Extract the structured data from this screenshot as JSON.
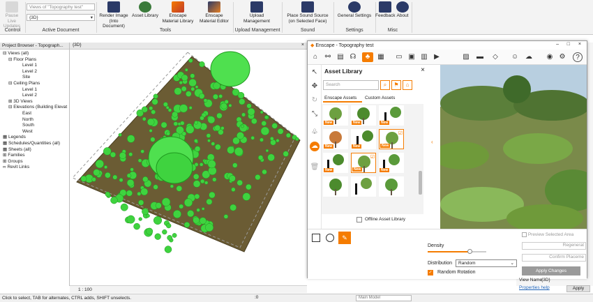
{
  "ribbon": {
    "pause_label": "Pause Live Updates",
    "view_combo": "Views of \"Topography test\"",
    "view_select": "{3D}",
    "render_image": "Render Image (Into Document)",
    "asset_library": "Asset Library",
    "material_library": "Enscape Material Library",
    "material_editor": "Enscape Material Editor",
    "upload": "Upload Management",
    "place_sound": "Place Sound Source (on Selected Face)",
    "general_settings": "General Settings",
    "feedback": "Feedback",
    "about": "About",
    "groups": {
      "control": "Control",
      "active_document": "Active Document",
      "tools": "Tools",
      "upload_mgmt": "Upload Management",
      "sound": "Sound",
      "settings": "Settings",
      "misc": "Misc"
    }
  },
  "project_browser": {
    "title": "Project Browser - Topograph...",
    "items": [
      "Views (all)",
      "Floor Plans",
      "Level 1",
      "Level 2",
      "Site",
      "Ceiling Plans",
      "Level 1",
      "Level 2",
      "3D Views",
      "Elevations (Building Elevat",
      "East",
      "North",
      "South",
      "West",
      "Legends",
      "Schedules/Quantities (all)",
      "Sheets (all)",
      "Families",
      "Groups",
      "Revit Links"
    ]
  },
  "view_tab": "{3D}",
  "view_scale": "1 : 100",
  "enscape": {
    "title": "Enscape - Topography test",
    "asset_library_title": "Asset Library",
    "search_placeholder": "Search",
    "tab_enscape": "Enscape Assets",
    "tab_custom": "Custom Assets",
    "new_badge": "New",
    "offline_label": "Offline Asset Library",
    "density_label": "Density",
    "distribution_label": "Distribution",
    "distribution_value": "Random",
    "random_rotation": "Random Rotation",
    "density_value": 0.72
  },
  "right_panel": {
    "preview_selected_area": "Preview Selected Area",
    "regenerate": "Regenerat",
    "confirm_placement": "Confirm Placeme",
    "apply_changes": "Apply Changes",
    "view_name_label": "View Name",
    "view_name_value": "{3D}",
    "properties_help": "Properties help",
    "apply": "Apply"
  },
  "status": {
    "message": "Click to select, TAB for alternates, CTRL adds, SHIFT unselects.",
    "model": "Main Model",
    "counter": ":0"
  },
  "colors": {
    "accent": "#f57c00",
    "grass": "#6b5c34",
    "tree": "#3fd33f"
  }
}
